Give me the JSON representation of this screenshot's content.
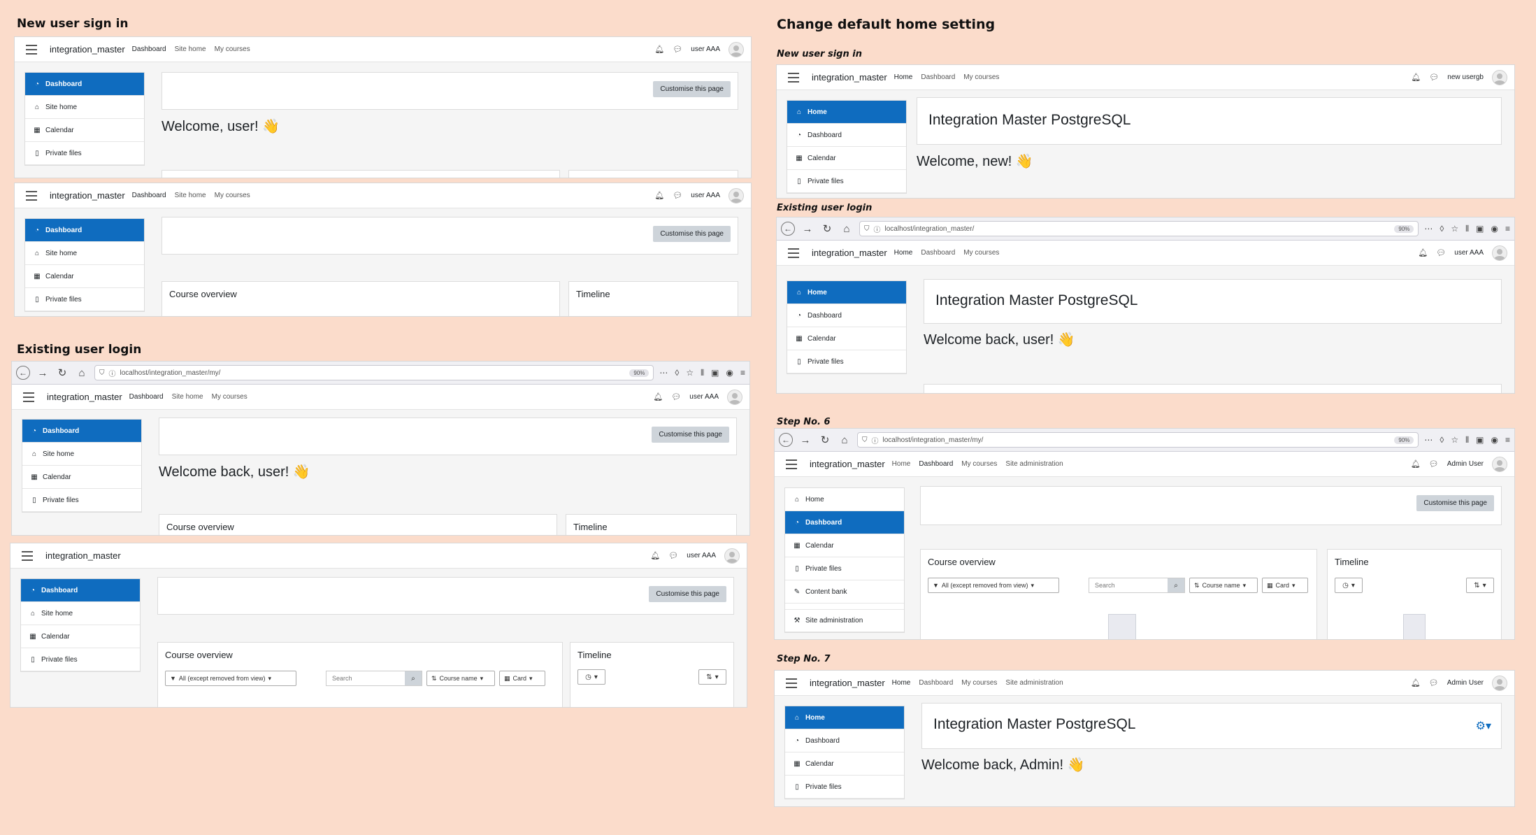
{
  "titles": {
    "left_new": "New user sign in",
    "left_existing": "Existing user login",
    "right_main": "Change default home setting",
    "right_new": "New user sign in",
    "right_existing": "Existing user login",
    "step6": "Step No. 6",
    "step7": "Step No. 7"
  },
  "common": {
    "brand": "integration_master",
    "customise": "Customise this page",
    "course_overview": "Course overview",
    "timeline": "Timeline",
    "filter_all": "All (except removed from view)",
    "search_placeholder": "Search",
    "sort_course_name": "Course name",
    "view_card": "Card"
  },
  "nav": {
    "home": "Home",
    "dashboard": "Dashboard",
    "site_home": "Site home",
    "my_courses": "My courses",
    "site_admin": "Site administration",
    "calendar": "Calendar",
    "private_files": "Private files",
    "content_bank": "Content bank"
  },
  "users": {
    "user_aaa": "user AAA",
    "new_usergb": "new usergb",
    "admin_user": "Admin User"
  },
  "browser": {
    "url": "localhost/integration_master/my/",
    "url_short": "localhost/integration_master/",
    "zoom": "90%"
  },
  "messages": {
    "welcome_user": "Welcome, user! 👋",
    "welcome_back_user": "Welcome back, user! 👋",
    "welcome_new": "Welcome, new! 👋",
    "welcome_back_admin": "Welcome back, Admin! 👋",
    "site_name": "Integration Master PostgreSQL"
  },
  "colors": {
    "background": "#fbdccb",
    "accent": "#0f6cbf",
    "button_grey": "#ced4da"
  }
}
